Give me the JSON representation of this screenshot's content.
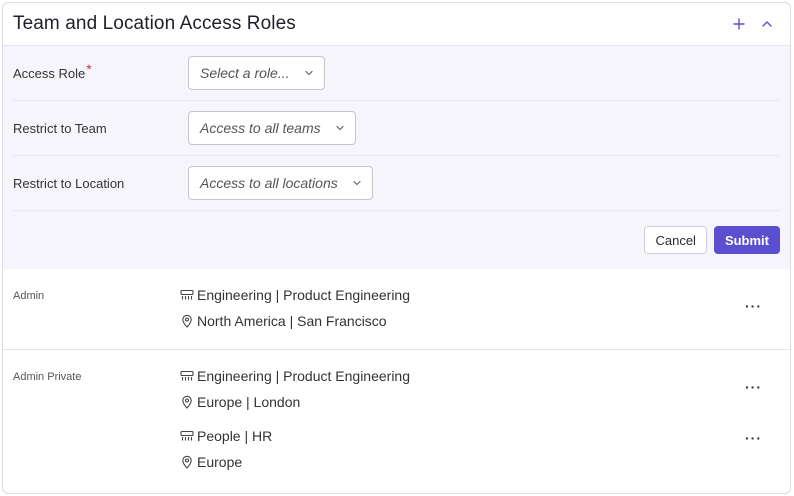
{
  "header": {
    "title": "Team and Location Access Roles"
  },
  "form": {
    "access_role_label": "Access Role",
    "access_role_required_mark": "*",
    "access_role_placeholder": "Select a role...",
    "team_label": "Restrict to Team",
    "team_value": "Access to all teams",
    "location_label": "Restrict to Location",
    "location_value": "Access to all locations",
    "cancel_label": "Cancel",
    "submit_label": "Submit"
  },
  "roles": [
    {
      "name": "Admin",
      "entries": [
        {
          "team": "Engineering | Product Engineering",
          "location": "North America | San Francisco",
          "more": "···"
        }
      ]
    },
    {
      "name": "Admin Private",
      "entries": [
        {
          "team": "Engineering | Product Engineering",
          "location": "Europe | London",
          "more": "···"
        },
        {
          "team": "People | HR",
          "location": "Europe",
          "more": "···"
        }
      ]
    }
  ],
  "colors": {
    "accent": "#5a4fcf",
    "form_background": "#f6f5fb",
    "required": "#d0323c"
  }
}
